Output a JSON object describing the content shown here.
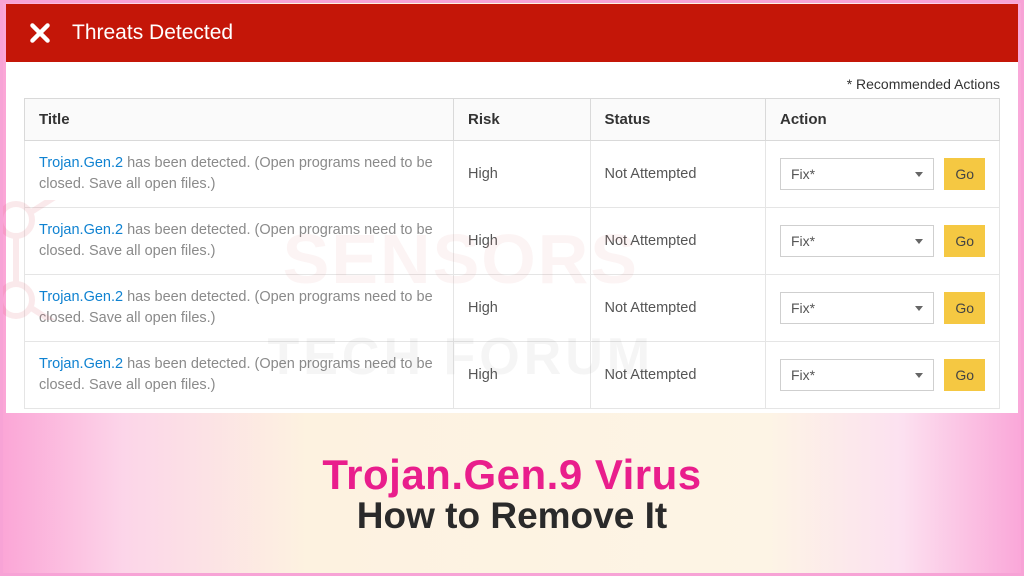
{
  "header": {
    "title": "Threats Detected"
  },
  "recommended_label": "* Recommended Actions",
  "columns": {
    "title": "Title",
    "risk": "Risk",
    "status": "Status",
    "action": "Action"
  },
  "rows": [
    {
      "threat": "Trojan.Gen.2",
      "desc": " has been detected. (Open programs need to be closed. Save all open files.)",
      "risk": "High",
      "status": "Not Attempted",
      "action_selected": "Fix*",
      "go": "Go"
    },
    {
      "threat": "Trojan.Gen.2",
      "desc": " has been detected. (Open programs need to be closed. Save all open files.)",
      "risk": "High",
      "status": "Not Attempted",
      "action_selected": "Fix*",
      "go": "Go"
    },
    {
      "threat": "Trojan.Gen.2",
      "desc": " has been detected. (Open programs need to be closed. Save all open files.)",
      "risk": "High",
      "status": "Not Attempted",
      "action_selected": "Fix*",
      "go": "Go"
    },
    {
      "threat": "Trojan.Gen.2",
      "desc": " has been detected. (Open programs need to be closed. Save all open files.)",
      "risk": "High",
      "status": "Not Attempted",
      "action_selected": "Fix*",
      "go": "Go"
    }
  ],
  "promo": {
    "line1": "Trojan.Gen.9 Virus",
    "line2": "How to Remove It"
  },
  "watermark": {
    "line1": "SENSORS",
    "line2": "TECH FORUM"
  }
}
